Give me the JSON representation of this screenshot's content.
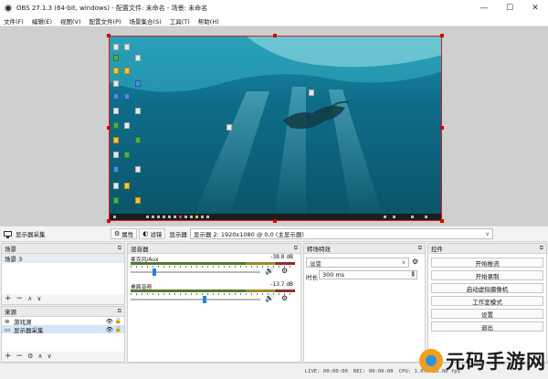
{
  "window": {
    "title": "OBS 27.1.3 (64-bit, windows) - 配置文件: 未命名 - 场景: 未命名",
    "controls": [
      "—",
      "☐",
      "✕"
    ]
  },
  "menu": [
    "文件(F)",
    "编辑(E)",
    "视图(V)",
    "配置文件(P)",
    "场景集合(S)",
    "工具(T)",
    "帮助(H)"
  ],
  "source_toolbar": {
    "source_name": "显示器采集",
    "properties_label": "属性",
    "filters_label": "滤镜",
    "display_label": "显示器",
    "display_value": "显示器 2: 1920x1080 @ 0,0 (主显示器)"
  },
  "scenes": {
    "header": "场景",
    "items": [
      "场景 3"
    ],
    "footer_buttons": [
      "+",
      "−",
      "∧",
      "∨"
    ]
  },
  "sources": {
    "header": "来源",
    "items": [
      {
        "icon": "game-capture-icon",
        "glyph": "⊚",
        "label": "游戏源",
        "selected": false
      },
      {
        "icon": "monitor-icon",
        "glyph": "▭",
        "label": "显示器采集",
        "selected": true
      }
    ],
    "footer_buttons": [
      "+",
      "−",
      "⚙",
      "∧",
      "∨"
    ]
  },
  "mixer": {
    "header": "混音器",
    "channels": [
      {
        "name": "麦克风/Aux",
        "db": "-38.8 dB",
        "volume_fraction": 0.18
      },
      {
        "name": "桌面音频",
        "db": "-13.7 dB",
        "volume_fraction": 0.57
      }
    ]
  },
  "transitions": {
    "header": "转场特效",
    "selected": "淡变",
    "duration_label": "时长",
    "duration_value": "300 ms"
  },
  "controls": {
    "header": "控件",
    "buttons": [
      "开始推流",
      "开始录制",
      "启动虚拟摄像机",
      "工作室模式",
      "设置",
      "退出"
    ]
  },
  "status": {
    "live": "LIVE: 00:00:00",
    "rec": "REC: 00:00:00",
    "cpu": "CPU: 1.0%, 30.00 fps"
  },
  "watermark": {
    "text": "元码手游网"
  },
  "colors": {
    "selection_border": "#d40000",
    "ocean_top": "#0f6d8a",
    "ocean_bottom": "#0a5468",
    "slider": "#2a7fd6"
  }
}
